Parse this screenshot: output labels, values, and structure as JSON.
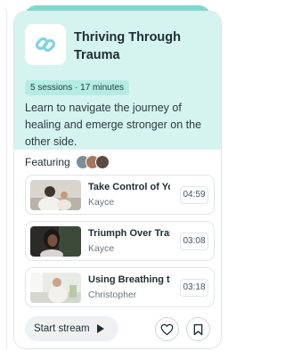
{
  "course": {
    "title": "Thriving Through Trauma",
    "meta": "5 sessions · 17 minutes",
    "description": "Learn to navigate the journey of healing and emerge stronger on the other side.",
    "accent_color": "#d6f4ef",
    "icon": "link-icon"
  },
  "featuring": {
    "label": "Featuring",
    "avatar_colors": [
      "#7b8e99",
      "#a8775f",
      "#5c4a44"
    ]
  },
  "tracks": [
    {
      "title": "Take Control of Yo...",
      "author": "Kayce",
      "duration": "04:59"
    },
    {
      "title": "Triumph Over Trau...",
      "author": "Kayce",
      "duration": "03:08"
    },
    {
      "title": "Using Breathing to...",
      "author": "Christopher",
      "duration": "03:18"
    }
  ],
  "actions": {
    "start_label": "Start stream",
    "play_icon": "play-icon",
    "favorite_icon": "heart-icon",
    "save_icon": "bookmark-icon"
  }
}
